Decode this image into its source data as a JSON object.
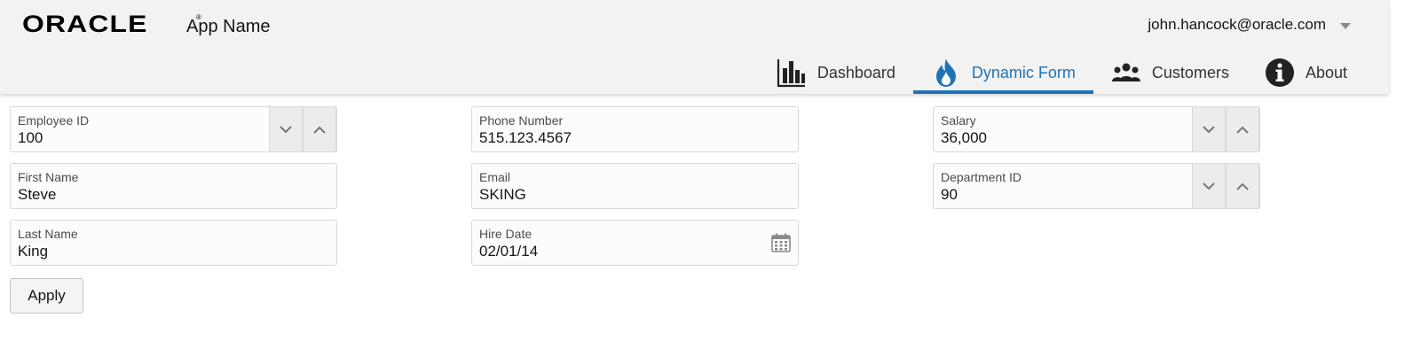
{
  "header": {
    "logo_text": "ORACLE",
    "logo_mark": "®",
    "app_name": "App Name",
    "user": "john.hancock@oracle.com",
    "user_menu_icon": "chevron-down-icon"
  },
  "nav": {
    "items": [
      {
        "label": "Dashboard",
        "icon": "bar-chart-icon",
        "selected": false
      },
      {
        "label": "Dynamic Form",
        "icon": "flame-icon",
        "selected": true
      },
      {
        "label": "Customers",
        "icon": "people-icon",
        "selected": false
      },
      {
        "label": "About",
        "icon": "info-icon",
        "selected": false
      }
    ],
    "selected_color": "#1e73b8"
  },
  "form": {
    "employee_id": {
      "label": "Employee ID",
      "value": "100"
    },
    "first_name": {
      "label": "First Name",
      "value": "Steve"
    },
    "last_name": {
      "label": "Last Name",
      "value": "King"
    },
    "phone_number": {
      "label": "Phone Number",
      "value": "515.123.4567"
    },
    "email": {
      "label": "Email",
      "value": "SKING"
    },
    "hire_date": {
      "label": "Hire Date",
      "value": "02/01/14",
      "icon": "calendar-icon"
    },
    "salary": {
      "label": "Salary",
      "value": "36,000"
    },
    "department_id": {
      "label": "Department ID",
      "value": "90"
    },
    "apply_label": "Apply"
  }
}
